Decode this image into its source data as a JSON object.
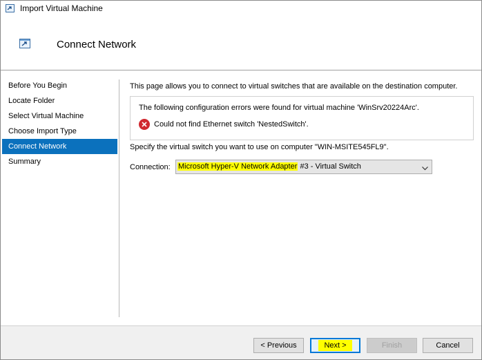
{
  "window": {
    "title": "Import Virtual Machine"
  },
  "header": {
    "title": "Connect Network"
  },
  "nav": {
    "items": [
      {
        "label": "Before You Begin"
      },
      {
        "label": "Locate Folder"
      },
      {
        "label": "Select Virtual Machine"
      },
      {
        "label": "Choose Import Type"
      },
      {
        "label": "Connect Network",
        "active": true
      },
      {
        "label": "Summary"
      }
    ]
  },
  "content": {
    "intro": "This page allows you to connect to virtual switches that are available on the destination computer.",
    "errors": {
      "heading": "The following configuration errors were found for virtual machine 'WinSrv20224Arc'.",
      "items": [
        "Could not find Ethernet switch 'NestedSwitch'."
      ]
    },
    "specify": "Specify the virtual switch you want to use on computer \"WIN-MSITE545FL9\".",
    "connection": {
      "label": "Connection:",
      "value_highlighted": "Microsoft Hyper-V Network Adapter",
      "value_rest": " #3 - Virtual Switch"
    }
  },
  "footer": {
    "previous": "< Previous",
    "next": "Next >",
    "finish": "Finish",
    "cancel": "Cancel"
  },
  "colors": {
    "nav_active": "#0b71bd",
    "error_icon": "#d0282f",
    "highlight": "#ffff00"
  }
}
